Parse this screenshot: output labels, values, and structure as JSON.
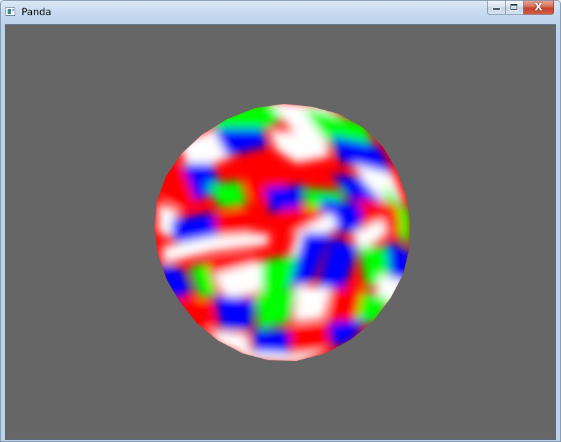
{
  "window": {
    "title": "Panda",
    "icon": "panda-app-icon",
    "caption_buttons": {
      "minimize_icon": "minimize-icon",
      "maximize_icon": "maximize-icon",
      "close_icon": "close-icon",
      "close_glyph": "X"
    }
  },
  "scene": {
    "background_color": "#666666",
    "object": "sphere",
    "colors": [
      "#ff0000",
      "#00ff00",
      "#0000ff",
      "#ffffff"
    ]
  }
}
